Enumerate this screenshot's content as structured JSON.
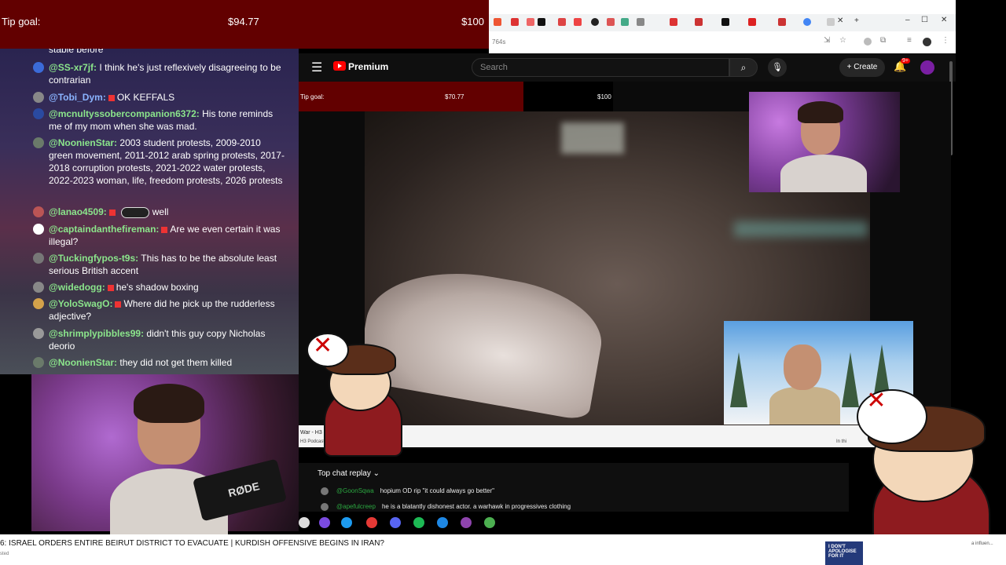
{
  "tip_goal": {
    "label": "Tip goal:",
    "current": "$94.77",
    "goal": "$100"
  },
  "inner_tip_goal": {
    "label": "Tip goal:",
    "current": "$70.77",
    "goal": "$100"
  },
  "chat": {
    "fragment": "stable before",
    "messages": [
      {
        "user": "@SS-xr7jf:",
        "text": "I think he's just reflexively disagreeing to be contrarian",
        "color": "blue"
      },
      {
        "user": "@Tobi_Dym:",
        "text": "OK KEFFALS",
        "color": "blue"
      },
      {
        "user": "@mcnultyssobercompanion6372:",
        "text": "His tone reminds me of my mom when she was mad.",
        "color": "green"
      },
      {
        "user": "@NoonienStar:",
        "text": "2003 student protests, 2009-2010 green movement, 2011-2012 arab spring protests, 2017-2018 corruption protests, 2021-2022 water protests, 2022-2023 woman, life, freedom protests, 2026 protests",
        "color": "green"
      },
      {
        "user": "@lanao4509:",
        "text": "well",
        "color": "green"
      },
      {
        "user": "@captaindanthefireman:",
        "text": "Are we even certain it was illegal?",
        "color": "green"
      },
      {
        "user": "@Tuckingfypos-t9s:",
        "text": "This has to be the absolute least serious British accent",
        "color": "green"
      },
      {
        "user": "@widedogg:",
        "text": "he's shadow boxing",
        "color": "green"
      },
      {
        "user": "@YoloSwagO:",
        "text": "Where did he pick up the rudderless adjective?",
        "color": "green"
      },
      {
        "user": "@shrimplypibbles99:",
        "text": "didn't this guy copy Nicholas deorio",
        "color": "green"
      },
      {
        "user": "@NoonienStar:",
        "text": "they did not get them killed",
        "color": "green"
      }
    ]
  },
  "webcam": {
    "mic_brand": "RØDE"
  },
  "browser": {
    "url_fragment": "764s"
  },
  "youtube": {
    "brand": "Premium",
    "search_placeholder": "Search",
    "create_label": "Create",
    "notif_count": "9+"
  },
  "video": {
    "title_fragment": "War - H3 S",
    "channel_fragment": "H3 Podcast",
    "right_fragment": "In thi"
  },
  "replay": {
    "header": "Top chat replay",
    "rows": [
      {
        "user": "@GoonSqwa",
        "text": "hopium OD rip \"it could always go better\""
      },
      {
        "user": "@apefulcreep",
        "text": "he is a blatantly dishonest actor. a warhawk in progressives clothing"
      }
    ]
  },
  "ticker": {
    "headline": "6: ISRAEL ORDERS ENTIRE BEIRUT DISTRICT TO EVACUATE | KURDISH OFFENSIVE BEGINS IN IRAN?",
    "sub": "sted"
  },
  "thumb": {
    "text": "I DON'T APOLOGISE FOR IT"
  },
  "side_right": {
    "text": "a influen..."
  },
  "colors": {
    "tip_bg": "#620000",
    "yt_red": "#ff0000",
    "chat_green": "#8be58b",
    "chat_blue": "#8ab4ff"
  }
}
